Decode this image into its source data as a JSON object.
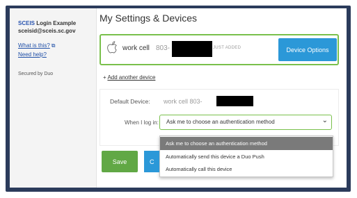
{
  "sidebar": {
    "org_brand": "SCEIS",
    "org_rest": " Login Example",
    "email": "sceisid@sceis.sc.gov",
    "whats_this": "What is this?",
    "need_help": "Need help?",
    "secured_by": "Secured by Duo"
  },
  "main": {
    "title": "My Settings & Devices",
    "device": {
      "name": "work cell",
      "number_prefix": "803-",
      "status": "JUST ADDED",
      "options_label": "Device Options"
    },
    "add_device": "Add another device",
    "default_device_label": "Default Device:",
    "default_device_value": "work cell 803-",
    "when_label": "When I log in:",
    "selected_option": "Ask me to choose an authentication method",
    "options": [
      "Ask me to choose an authentication method",
      "Automatically send this device a Duo Push",
      "Automatically call this device"
    ],
    "save_label": "Save",
    "cancel_label": "C"
  },
  "colors": {
    "frame": "#2b3b5b",
    "accent_green": "#79c04b",
    "button_blue": "#2b98d8",
    "save_green": "#61a845"
  }
}
